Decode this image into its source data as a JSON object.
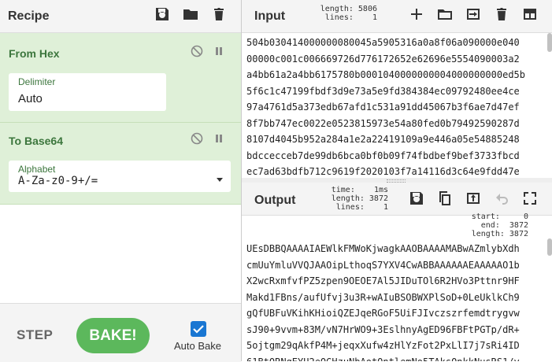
{
  "recipe": {
    "title": "Recipe",
    "ops": [
      {
        "name": "From Hex",
        "fields": [
          {
            "label": "Delimiter",
            "value": "Auto"
          }
        ]
      },
      {
        "name": "To Base64",
        "fields": [
          {
            "label": "Alphabet",
            "value": "A-Za-z0-9+/="
          }
        ]
      }
    ]
  },
  "controls": {
    "step": "STEP",
    "bake": "BAKE!",
    "auto_bake": "Auto Bake",
    "auto_bake_checked": true
  },
  "input": {
    "title": "Input",
    "length_label": "length:",
    "length": "5806",
    "lines_label": "lines:",
    "lines": "1",
    "lines_text": [
      "504b030414000000080045a5905316a0a8f06a090000e040",
      "00000c001c006669726d776172652e62696e5554090003a2",
      "a4bb61a2a4bb6175780b0001040000000004000000000ed5b",
      "5f6c1c47199fbdf3d9e73a5e9fd384384ec09792480ee4ce",
      "97a4761d5a373edb67afd1c531a91dd45067b3f6ae7d47ef",
      "8f7bb747ec0022e0523815973e54a80fed0b79492590287d",
      "8107d4045b952a284a1e2a22419109a9e446a05e54885248",
      "bdccecceb7de99db6bca0bf0b09f74fbdbef9bef3733fbcd",
      "ec7ad63bdfb712c9619f2020103f7a14116d3c64e9fdd47e"
    ]
  },
  "output": {
    "title": "Output",
    "time_label": "time:",
    "time": "1ms",
    "length_label": "length:",
    "length": "3872",
    "lines_label": "lines:",
    "lines": "1",
    "start_label": "start:",
    "start": "0",
    "end_label": "end:",
    "end": "3872",
    "sel_length_label": "length:",
    "sel_length": "3872",
    "lines_text": [
      "UEsDBBQAAAAIAEWlkFMWoKjwagkAAOBAAAAMABwAZmlybXdh",
      "cmUuYmluVVQJAAOipLthoqS7YXV4CwABBAAAAAAEAAAAAO1b",
      "X2wcRxmfvfPZ5zpen9OEOE7Al5JIDuTOl6R2HVo3Pttnr9HF",
      "Makd1FBns/aufUfvj3u3R+wAIuBSOBWXPlSoD+0LeUklkCh9",
      "gQfUBFuVKihKHioiQZEJqeRGoF5UiFJIvczszrfemdtrygvw",
      "sJ90+9vvm+83M/vN7HrWO9+3EslhnyAgED96FBFtPGTp/dR+",
      "5ojtgm29qAkfP4M+jeqxXufw4zHlYzFot2PxLlI7j7sRi4ID",
      "61BtORNgEYU2eOGHzuNbAotOntlemNo5TAksOnkkNusRS1/y"
    ]
  }
}
